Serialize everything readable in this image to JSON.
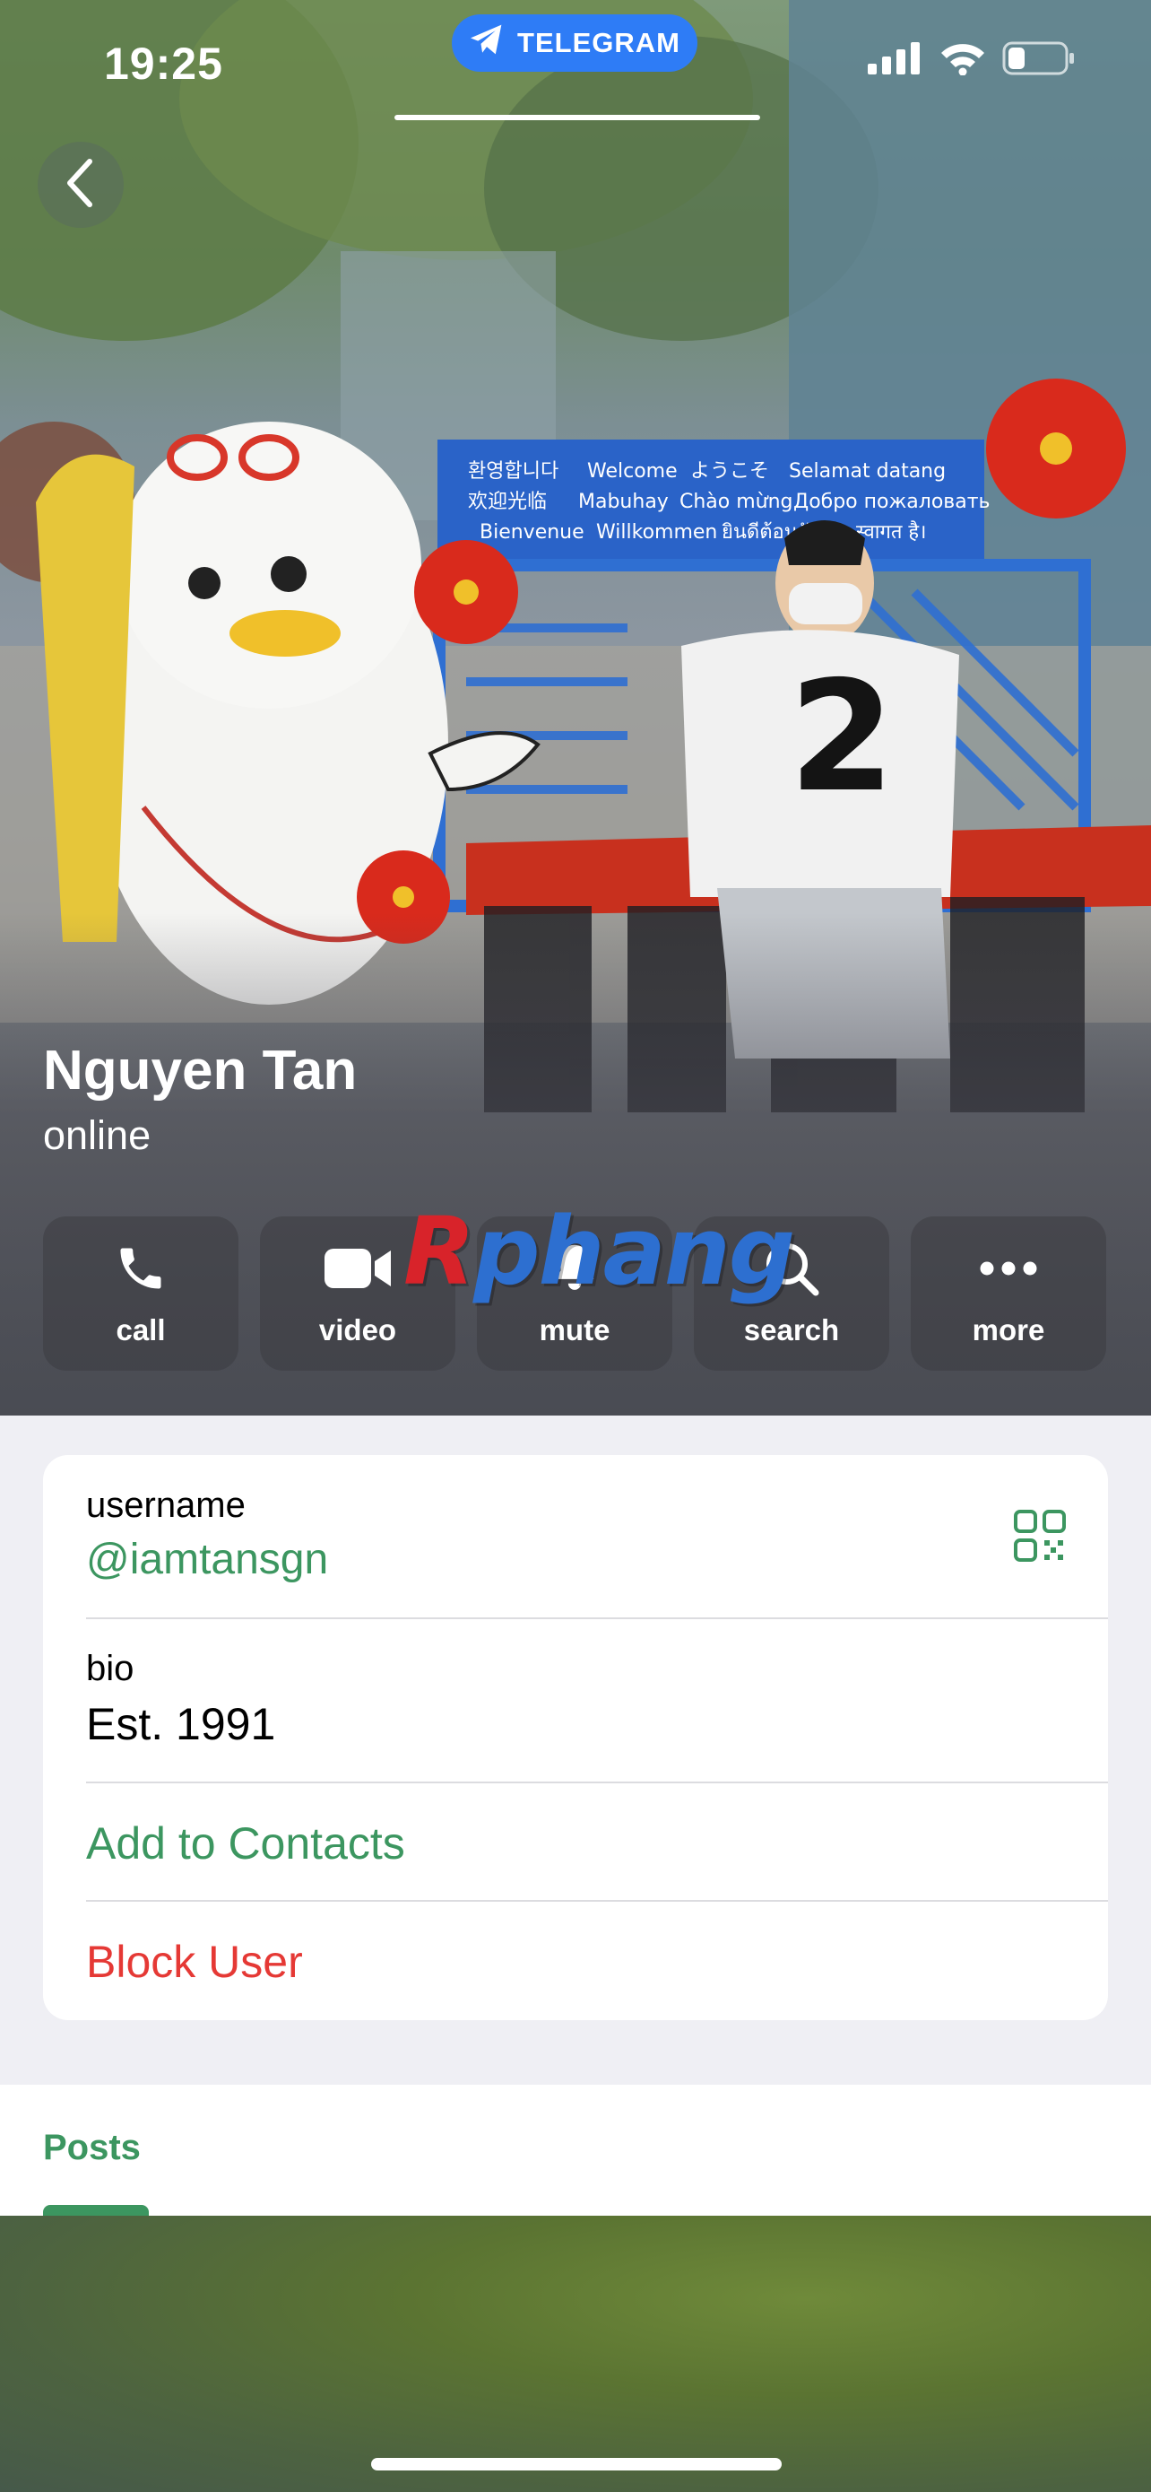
{
  "status_bar": {
    "time": "19:25",
    "app_pill": "TELEGRAM",
    "icons": [
      "signal-icon",
      "wifi-icon",
      "battery-icon"
    ],
    "battery_level": 0.3
  },
  "story_progress": 1.0,
  "profile": {
    "name": "Nguyen Tan",
    "status": "online"
  },
  "actions": [
    {
      "label": "call",
      "icon": "phone-icon"
    },
    {
      "label": "video",
      "icon": "video-camera-icon"
    },
    {
      "label": "mute",
      "icon": "bell-icon"
    },
    {
      "label": "search",
      "icon": "search-icon"
    },
    {
      "label": "more",
      "icon": "more-dots-icon"
    }
  ],
  "photo_signs": {
    "line1": [
      "환영합니다",
      "Welcome",
      "ようこそ",
      "Selamat datang"
    ],
    "line2": [
      "欢迎光临",
      "Mabuhay",
      "Chào mừng",
      "Добро пожаловать"
    ],
    "line3": [
      "Bienvenue",
      "Willkommen",
      "ยินดีต้อนรับ",
      "स्वागत है।"
    ]
  },
  "watermark": {
    "first": "R",
    "rest": "phang"
  },
  "info": {
    "username_label": "username",
    "username_value": "@iamtansgn",
    "bio_label": "bio",
    "bio_value": "Est. 1991",
    "add_contact": "Add to Contacts",
    "block_user": "Block User"
  },
  "tabs": {
    "posts": "Posts"
  },
  "colors": {
    "accent_green": "#3c9660",
    "danger_red": "#e53935",
    "telegram_blue": "#2e7cf6",
    "background": "#efeff4"
  }
}
